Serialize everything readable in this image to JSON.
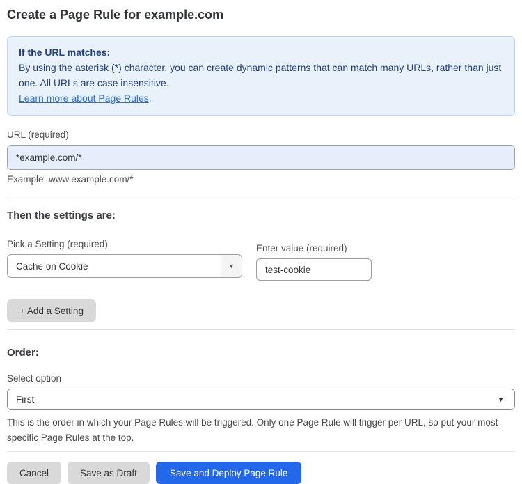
{
  "page": {
    "title": "Create a Page Rule for example.com"
  },
  "info_box": {
    "heading": "If the URL matches:",
    "body": "By using the asterisk (*) character, you can create dynamic patterns that can match many URLs, rather than just one. All URLs are case insensitive.",
    "link_label": "Learn more about Page Rules",
    "link_suffix": "."
  },
  "url_field": {
    "label": "URL (required)",
    "value": "*example.com/*",
    "hint": "Example: www.example.com/*"
  },
  "settings_section": {
    "heading": "Then the settings are:",
    "setting_label": "Pick a Setting (required)",
    "setting_value": "Cache on Cookie",
    "value_label": "Enter value (required)",
    "value_value": "test-cookie",
    "add_setting_label": "+ Add a Setting"
  },
  "order_section": {
    "heading": "Order:",
    "select_label": "Select option",
    "selected_option": "First",
    "help_text": "This is the order in which your Page Rules will be triggered. Only one Page Rule will trigger per URL, so put your most specific Page Rules at the top."
  },
  "footer": {
    "cancel_label": "Cancel",
    "save_draft_label": "Save as Draft",
    "save_deploy_label": "Save and Deploy Page Rule"
  },
  "icons": {
    "dropdown_arrow": "▼"
  },
  "colors": {
    "info_background": "#e9f1fb",
    "info_border": "#bcd7f2",
    "info_text": "#24407a",
    "link_blue": "#2f6fd0",
    "url_input_background": "#e7eefb",
    "primary_button_blue": "#2268e8",
    "gray_button": "#d9d9d9"
  }
}
